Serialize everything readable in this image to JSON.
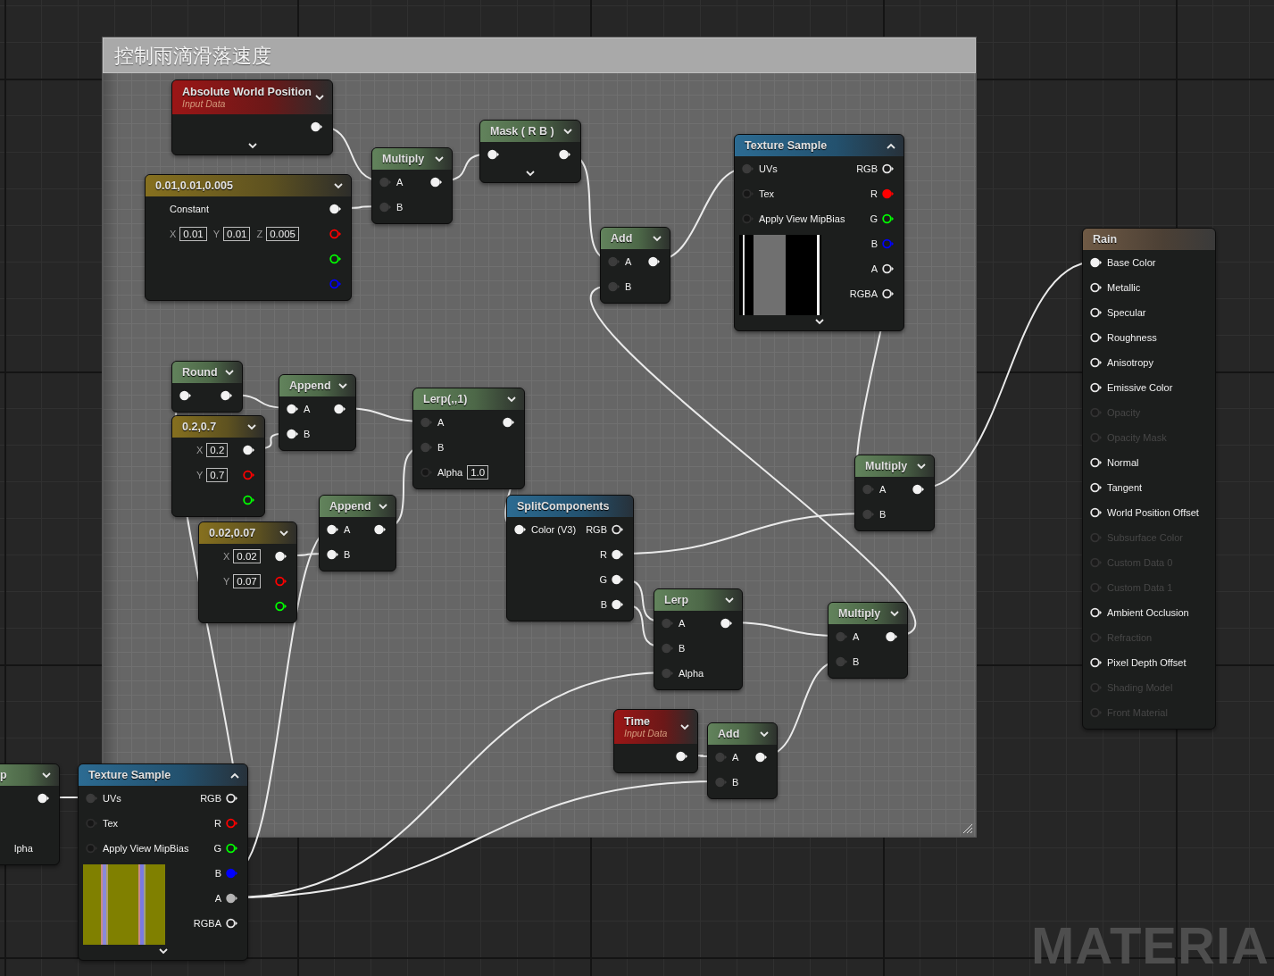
{
  "comment": {
    "title": "控制雨滴滑落速度"
  },
  "nodes": [
    {
      "kind": "input",
      "title": "Absolute World Position",
      "subtitle": "Input Data",
      "expanded": false,
      "advanced_pins": true,
      "rows": [
        {
          "out": {
            "kind": "filled"
          }
        }
      ]
    },
    {
      "kind": "constant",
      "title": "0.01,0.01,0.005",
      "expanded": false,
      "rows": [
        {
          "label": "Constant",
          "out": {
            "kind": "filled"
          }
        },
        {
          "fields": [
            {
              "axis": "X",
              "value": "0.01"
            },
            {
              "axis": "Y",
              "value": "0.01"
            },
            {
              "axis": "Z",
              "value": "0.005"
            }
          ],
          "out": {
            "kind": "ring",
            "color": "#ff0000"
          }
        },
        {
          "out": {
            "kind": "ring",
            "color": "#00ff00"
          }
        },
        {
          "out": {
            "kind": "ring",
            "color": "#0000ff"
          }
        }
      ]
    },
    {
      "kind": "math",
      "title": "Multiply",
      "expanded": false,
      "rows": [
        {
          "in": {
            "kind": "dim"
          },
          "label": "A",
          "out": {
            "kind": "filled"
          }
        },
        {
          "in": {
            "kind": "dim"
          },
          "label": "B"
        }
      ]
    },
    {
      "kind": "math",
      "title": "Mask ( R B )",
      "expanded": false,
      "advanced_pins": true,
      "rows": [
        {
          "in": {
            "kind": "filled"
          },
          "out": {
            "kind": "filled"
          }
        }
      ]
    },
    {
      "kind": "math",
      "title": "Add",
      "expanded": false,
      "rows": [
        {
          "in": {
            "kind": "dim"
          },
          "label": "A",
          "out": {
            "kind": "filled"
          }
        },
        {
          "in": {
            "kind": "dim"
          },
          "label": "B"
        }
      ]
    },
    {
      "kind": "texture",
      "title": "Texture Sample",
      "expanded": true,
      "advanced_pins": true,
      "rows": [
        {
          "in": {
            "kind": "dim"
          },
          "label": "UVs",
          "out_label": "RGB",
          "out": {
            "kind": "ring"
          }
        },
        {
          "in": {
            "kind": "empty"
          },
          "label": "Tex",
          "out_label": "R",
          "out": {
            "kind": "filled",
            "color": "#ff0000"
          }
        },
        {
          "in": {
            "kind": "empty"
          },
          "label": "Apply View MipBias",
          "out_label": "G",
          "out": {
            "kind": "ring",
            "color": "#00ff00"
          }
        },
        {
          "out_label": "B",
          "out": {
            "kind": "ring",
            "color": "#0000ff"
          }
        },
        {
          "out_label": "A",
          "out": {
            "kind": "ring"
          }
        },
        {
          "out_label": "RGBA",
          "out": {
            "kind": "ring"
          }
        }
      ]
    },
    {
      "kind": "result",
      "title": "Rain",
      "rows": [
        {
          "in": {
            "kind": "filled"
          },
          "label": "Base Color",
          "disabled": false
        },
        {
          "in": {
            "kind": "ring"
          },
          "label": "Metallic",
          "disabled": false
        },
        {
          "in": {
            "kind": "ring"
          },
          "label": "Specular",
          "disabled": false
        },
        {
          "in": {
            "kind": "ring"
          },
          "label": "Roughness",
          "disabled": false
        },
        {
          "in": {
            "kind": "ring"
          },
          "label": "Anisotropy",
          "disabled": false
        },
        {
          "in": {
            "kind": "ring"
          },
          "label": "Emissive Color",
          "disabled": false
        },
        {
          "in": {
            "kind": "ring"
          },
          "label": "Opacity",
          "disabled": true
        },
        {
          "in": {
            "kind": "ring"
          },
          "label": "Opacity Mask",
          "disabled": true
        },
        {
          "in": {
            "kind": "ring"
          },
          "label": "Normal",
          "disabled": false
        },
        {
          "in": {
            "kind": "ring"
          },
          "label": "Tangent",
          "disabled": false
        },
        {
          "in": {
            "kind": "ring"
          },
          "label": "World Position Offset",
          "disabled": false
        },
        {
          "in": {
            "kind": "ring"
          },
          "label": "Subsurface Color",
          "disabled": true
        },
        {
          "in": {
            "kind": "ring"
          },
          "label": "Custom Data 0",
          "disabled": true
        },
        {
          "in": {
            "kind": "ring"
          },
          "label": "Custom Data 1",
          "disabled": true
        },
        {
          "in": {
            "kind": "ring"
          },
          "label": "Ambient Occlusion",
          "disabled": false
        },
        {
          "in": {
            "kind": "ring"
          },
          "label": "Refraction",
          "disabled": true
        },
        {
          "in": {
            "kind": "ring"
          },
          "label": "Pixel Depth Offset",
          "disabled": false
        },
        {
          "in": {
            "kind": "ring"
          },
          "label": "Shading Model",
          "disabled": true
        },
        {
          "in": {
            "kind": "ring"
          },
          "label": "Front Material",
          "disabled": true
        }
      ]
    },
    {
      "kind": "math",
      "title": "Round",
      "expanded": false,
      "rows": [
        {
          "in": {
            "kind": "filled"
          },
          "out": {
            "kind": "filled"
          }
        }
      ]
    },
    {
      "kind": "constant",
      "title": "0.2,0.7",
      "expanded": false,
      "rows": [
        {
          "fields": [
            {
              "axis": "X",
              "value": "0.2"
            }
          ],
          "out": {
            "kind": "filled"
          }
        },
        {
          "fields": [
            {
              "axis": "Y",
              "value": "0.7"
            }
          ],
          "out": {
            "kind": "ring",
            "color": "#ff0000"
          }
        },
        {
          "out": {
            "kind": "ring",
            "color": "#00ff00"
          }
        }
      ]
    },
    {
      "kind": "math",
      "title": "Append",
      "expanded": false,
      "rows": [
        {
          "in": {
            "kind": "filled"
          },
          "label": "A",
          "out": {
            "kind": "filled"
          }
        },
        {
          "in": {
            "kind": "filled"
          },
          "label": "B"
        }
      ]
    },
    {
      "kind": "math",
      "title": "Lerp(,,1)",
      "expanded": false,
      "rows": [
        {
          "in": {
            "kind": "dim"
          },
          "label": "A",
          "out": {
            "kind": "filled"
          }
        },
        {
          "in": {
            "kind": "dim"
          },
          "label": "B"
        },
        {
          "in": {
            "kind": "empty"
          },
          "label": "Alpha",
          "value": "1.0"
        }
      ]
    },
    {
      "kind": "math",
      "title": "Append",
      "expanded": false,
      "rows": [
        {
          "in": {
            "kind": "filled"
          },
          "label": "A",
          "out": {
            "kind": "filled"
          }
        },
        {
          "in": {
            "kind": "filled"
          },
          "label": "B"
        }
      ]
    },
    {
      "kind": "constant",
      "title": "0.02,0.07",
      "expanded": false,
      "rows": [
        {
          "fields": [
            {
              "axis": "X",
              "value": "0.02"
            }
          ],
          "out": {
            "kind": "filled"
          }
        },
        {
          "fields": [
            {
              "axis": "Y",
              "value": "0.07"
            }
          ],
          "out": {
            "kind": "ring",
            "color": "#ff0000"
          }
        },
        {
          "out": {
            "kind": "ring",
            "color": "#00ff00"
          }
        }
      ]
    },
    {
      "kind": "utility",
      "title": "SplitComponents",
      "rows": [
        {
          "in": {
            "kind": "filled"
          },
          "label": "Color (V3)",
          "out_label": "RGB",
          "out": {
            "kind": "ring"
          }
        },
        {
          "out_label": "R",
          "out": {
            "kind": "filled"
          }
        },
        {
          "out_label": "G",
          "out": {
            "kind": "filled"
          }
        },
        {
          "out_label": "B",
          "out": {
            "kind": "filled"
          }
        }
      ]
    },
    {
      "kind": "math",
      "title": "Lerp",
      "expanded": false,
      "rows": [
        {
          "in": {
            "kind": "dim"
          },
          "label": "A",
          "out": {
            "kind": "filled"
          }
        },
        {
          "in": {
            "kind": "dim"
          },
          "label": "B"
        },
        {
          "in": {
            "kind": "dim"
          },
          "label": "Alpha"
        }
      ]
    },
    {
      "kind": "math",
      "title": "Multiply",
      "expanded": false,
      "rows": [
        {
          "in": {
            "kind": "dim"
          },
          "label": "A",
          "out": {
            "kind": "filled"
          }
        },
        {
          "in": {
            "kind": "dim"
          },
          "label": "B"
        }
      ]
    },
    {
      "kind": "math",
      "title": "Multiply",
      "expanded": false,
      "rows": [
        {
          "in": {
            "kind": "dim"
          },
          "label": "A",
          "out": {
            "kind": "filled"
          }
        },
        {
          "in": {
            "kind": "dim"
          },
          "label": "B"
        }
      ]
    },
    {
      "kind": "input",
      "title": "Time",
      "subtitle": "Input Data",
      "expanded": false,
      "rows": [
        {
          "out": {
            "kind": "filled"
          }
        }
      ]
    },
    {
      "kind": "math",
      "title": "Add",
      "expanded": false,
      "rows": [
        {
          "in": {
            "kind": "dim"
          },
          "label": "A",
          "out": {
            "kind": "filled"
          }
        },
        {
          "in": {
            "kind": "dim"
          },
          "label": "B"
        }
      ]
    },
    {
      "kind": "math",
      "title": "p",
      "expanded": false,
      "rows": [
        {
          "out": {
            "kind": "filled"
          }
        },
        {},
        {
          "label": "lpha"
        }
      ]
    },
    {
      "kind": "texture",
      "title": "Texture Sample",
      "expanded": true,
      "advanced_pins": true,
      "rows": [
        {
          "in": {
            "kind": "dim"
          },
          "label": "UVs",
          "out_label": "RGB",
          "out": {
            "kind": "ring"
          }
        },
        {
          "in": {
            "kind": "empty"
          },
          "label": "Tex",
          "out_label": "R",
          "out": {
            "kind": "ring",
            "color": "#ff0000"
          }
        },
        {
          "in": {
            "kind": "empty"
          },
          "label": "Apply View MipBias",
          "out_label": "G",
          "out": {
            "kind": "ring",
            "color": "#00ff00"
          }
        },
        {
          "out_label": "B",
          "out": {
            "kind": "filled",
            "color": "#0000ff"
          }
        },
        {
          "out_label": "A",
          "out": {
            "kind": "filled",
            "color": "#b4b4b4"
          }
        },
        {
          "out_label": "RGBA",
          "out": {
            "kind": "ring"
          }
        }
      ]
    }
  ],
  "graph_type": "MATERIA"
}
